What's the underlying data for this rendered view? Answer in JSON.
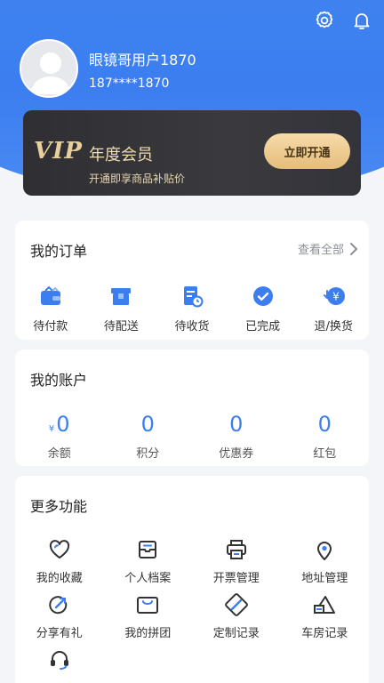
{
  "user": {
    "name": "眼镜哥用户1870",
    "phone": "187****1870"
  },
  "vip": {
    "logo": "VIP",
    "title": "年度会员",
    "subtitle": "开通即享商品补贴价",
    "button": "立即开通"
  },
  "orders": {
    "title": "我的订单",
    "view_all": "查看全部",
    "items": [
      {
        "label": "待付款",
        "icon": "wallet-icon"
      },
      {
        "label": "待配送",
        "icon": "box-icon"
      },
      {
        "label": "待收货",
        "icon": "receipt-clock-icon"
      },
      {
        "label": "已完成",
        "icon": "check-circle-icon"
      },
      {
        "label": "退/换货",
        "icon": "refund-icon"
      }
    ]
  },
  "account": {
    "title": "我的账户",
    "currency": "¥",
    "items": [
      {
        "label": "余额",
        "value": "0"
      },
      {
        "label": "积分",
        "value": "0"
      },
      {
        "label": "优惠券",
        "value": "0"
      },
      {
        "label": "红包",
        "value": "0"
      }
    ]
  },
  "more": {
    "title": "更多功能",
    "items": [
      {
        "label": "我的收藏",
        "icon": "heart-icon"
      },
      {
        "label": "个人档案",
        "icon": "archive-icon"
      },
      {
        "label": "开票管理",
        "icon": "printer-icon"
      },
      {
        "label": "地址管理",
        "icon": "location-icon"
      },
      {
        "label": "分享有礼",
        "icon": "share-icon"
      },
      {
        "label": "我的拼团",
        "icon": "group-bag-icon"
      },
      {
        "label": "定制记录",
        "icon": "ruler-pencil-icon"
      },
      {
        "label": "车房记录",
        "icon": "car-house-icon"
      },
      {
        "label": "",
        "icon": "headset-icon"
      }
    ]
  },
  "colors": {
    "primary": "#3c7ef0",
    "vip_gold": "#e9cf9b",
    "vip_dark": "#333336"
  }
}
